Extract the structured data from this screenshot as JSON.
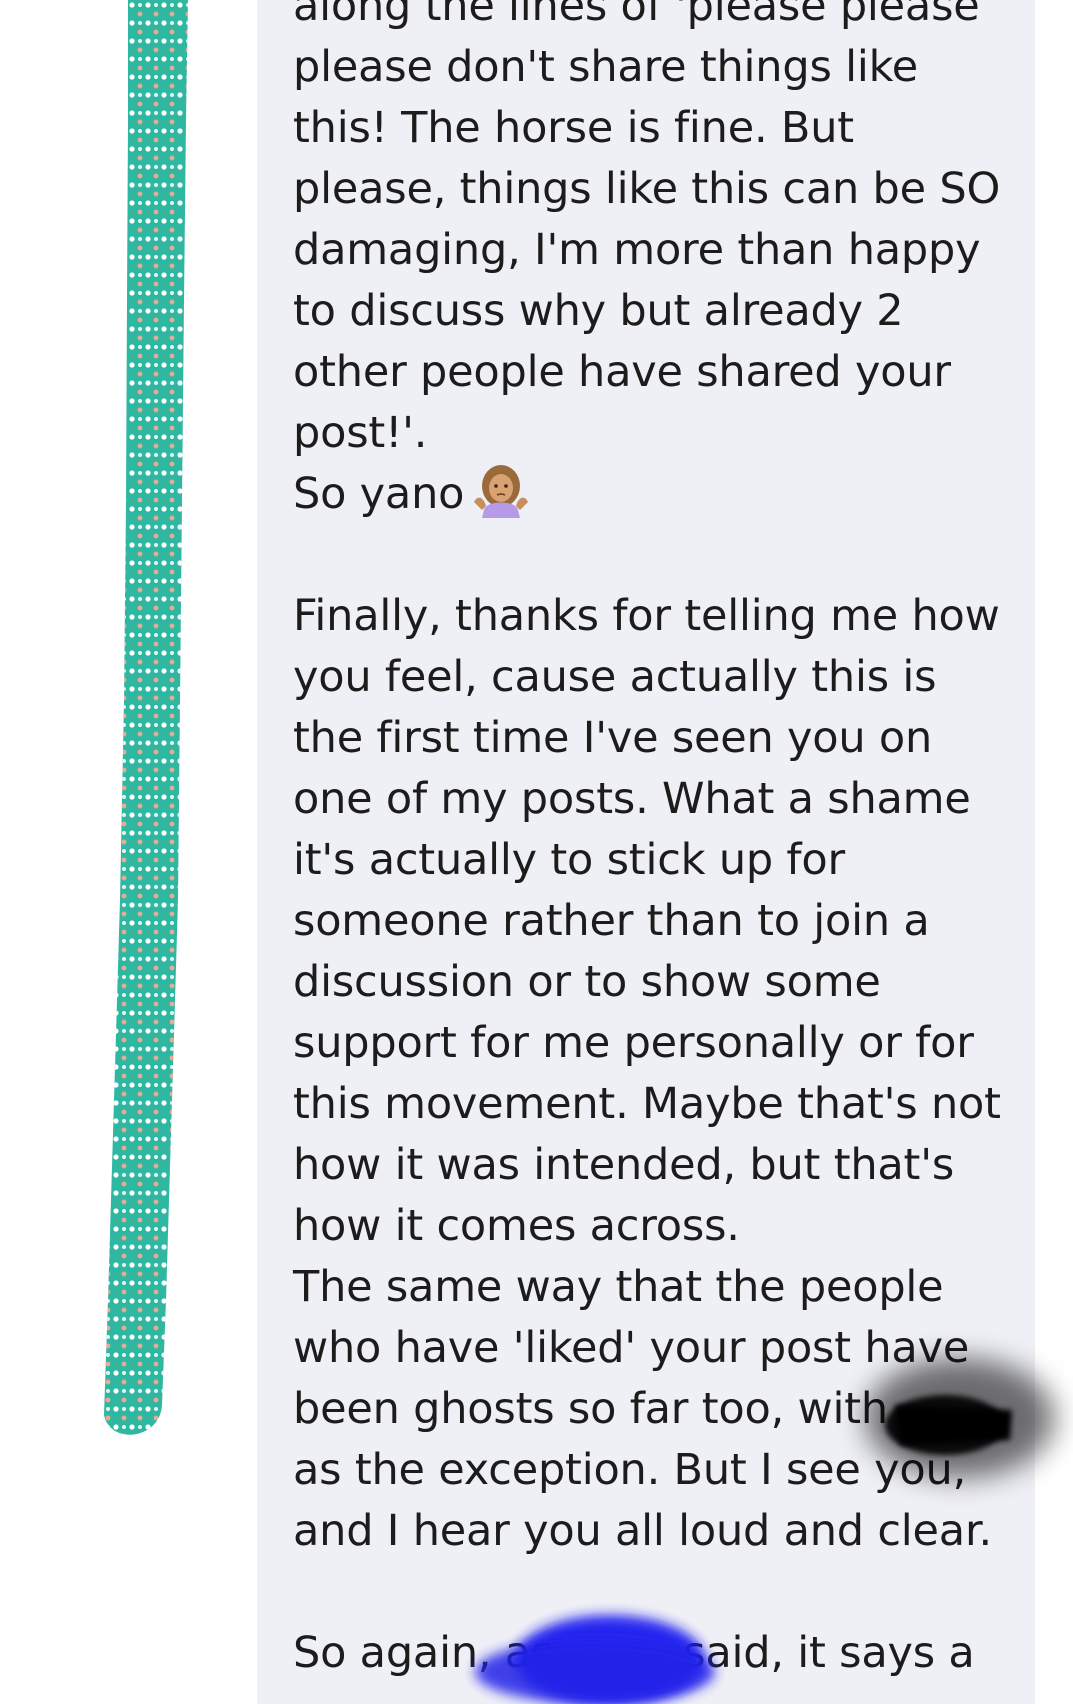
{
  "comment": {
    "lines_block1": [
      "along the lines of 'please please",
      "please don't share things like",
      "this! The horse is fine. But",
      "please, things like this can be SO",
      "damaging, I'm more than happy",
      "to discuss why but already 2",
      "other people have shared your",
      "post!'."
    ],
    "so_yano": "So yano",
    "emoji": "person-shrugging-icon",
    "lines_block2": [
      "Finally, thanks for telling me how",
      "you feel, cause actually this is",
      "the first time I've seen you on",
      "one of my posts. What a shame",
      "it's actually to stick up for",
      "someone rather than to join a",
      "discussion or to show some",
      "support for me personally or for",
      "this movement. Maybe that's not",
      "how it was intended, but that's",
      "how it comes across.",
      "The same way that the people",
      "who have 'liked' your post have",
      "been ghosts so far too, with",
      "as the exception. But I see you,",
      "and I hear you all loud and clear."
    ],
    "lines_block3": [
      "So again, as",
      "said, it says a"
    ]
  },
  "colors": {
    "bubble_background": "#eff0f6",
    "text": "#1c1c1c",
    "scribble_green": "#2fb7a1",
    "redaction_black": "#000000",
    "redaction_blue": "#1a1af0"
  }
}
